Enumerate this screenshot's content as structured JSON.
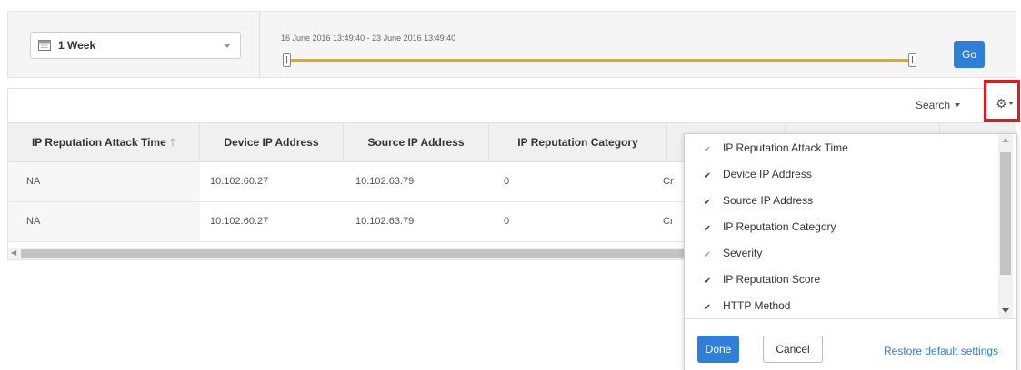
{
  "filter": {
    "range_label": "1 Week",
    "range_text": "16 June 2016 13:49:40 - 23 June 2016 13:49:40",
    "go_label": "Go",
    "accent_color": "#f0a020"
  },
  "toolbar": {
    "search_label": "Search"
  },
  "table": {
    "headers": [
      "IP Reputation Attack Time",
      "Device IP Address",
      "Source IP Address",
      "IP Reputation Category"
    ],
    "sort_icon": "arrow-up-icon",
    "rows": [
      {
        "time": "NA",
        "device_ip": "10.102.60.27",
        "source_ip": "10.102.63.79",
        "category": "0",
        "partial": "Cr"
      },
      {
        "time": "NA",
        "device_ip": "10.102.60.27",
        "source_ip": "10.102.63.79",
        "category": "0",
        "partial": "Cr"
      }
    ]
  },
  "column_chooser": {
    "options": [
      {
        "label": "IP Reputation Attack Time",
        "checked": true,
        "disabled": true
      },
      {
        "label": "Device IP Address",
        "checked": true,
        "disabled": false
      },
      {
        "label": "Source IP Address",
        "checked": true,
        "disabled": false
      },
      {
        "label": "IP Reputation Category",
        "checked": true,
        "disabled": false
      },
      {
        "label": "Severity",
        "checked": true,
        "disabled": true
      },
      {
        "label": "IP Reputation Score",
        "checked": true,
        "disabled": false
      },
      {
        "label": "HTTP Method",
        "checked": true,
        "disabled": false
      }
    ],
    "done_label": "Done",
    "cancel_label": "Cancel",
    "restore_label": "Restore default settings"
  },
  "colors": {
    "primary_button": "#2f7ed8",
    "highlight_box": "#e8161d"
  }
}
